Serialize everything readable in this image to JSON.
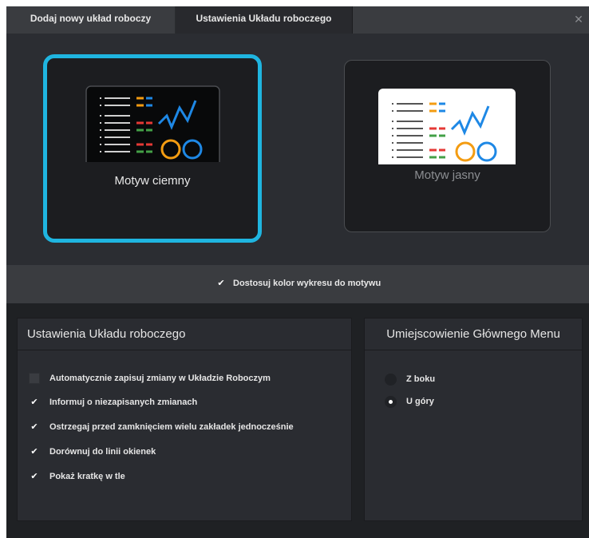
{
  "tabs": [
    {
      "label": "Dodaj nowy układ roboczy",
      "active": false
    },
    {
      "label": "Ustawienia Układu roboczego",
      "active": true
    }
  ],
  "close_icon": "close-icon",
  "themes": {
    "dark": {
      "label": "Motyw ciemny",
      "selected": true,
      "accent": "#1fb5e0"
    },
    "light": {
      "label": "Motyw jasny",
      "selected": false
    }
  },
  "match_chart": {
    "label": "Dostosuj kolor wykresu do motywu",
    "checked": true
  },
  "workspace_settings": {
    "title": "Ustawienia Układu roboczego",
    "options": [
      {
        "label": "Automatycznie zapisuj zmiany w Układzie Roboczym",
        "checked": false
      },
      {
        "label": "Informuj o niezapisanych zmianach",
        "checked": true
      },
      {
        "label": "Ostrzegaj przed zamknięciem wielu zakładek jednocześnie",
        "checked": true
      },
      {
        "label": "Dorównuj do linii okienek",
        "checked": true
      },
      {
        "label": "Pokaż kratkę w tle",
        "checked": true
      }
    ]
  },
  "menu_location": {
    "title": "Umiejscowienie Głównego Menu",
    "options": [
      {
        "label": "Z boku",
        "selected": false
      },
      {
        "label": "U góry",
        "selected": true
      }
    ]
  },
  "colors": {
    "accent": "#1fb5e0",
    "orange": "#f39c12",
    "blue": "#1e88e5",
    "red": "#e53935",
    "green": "#43a047"
  }
}
